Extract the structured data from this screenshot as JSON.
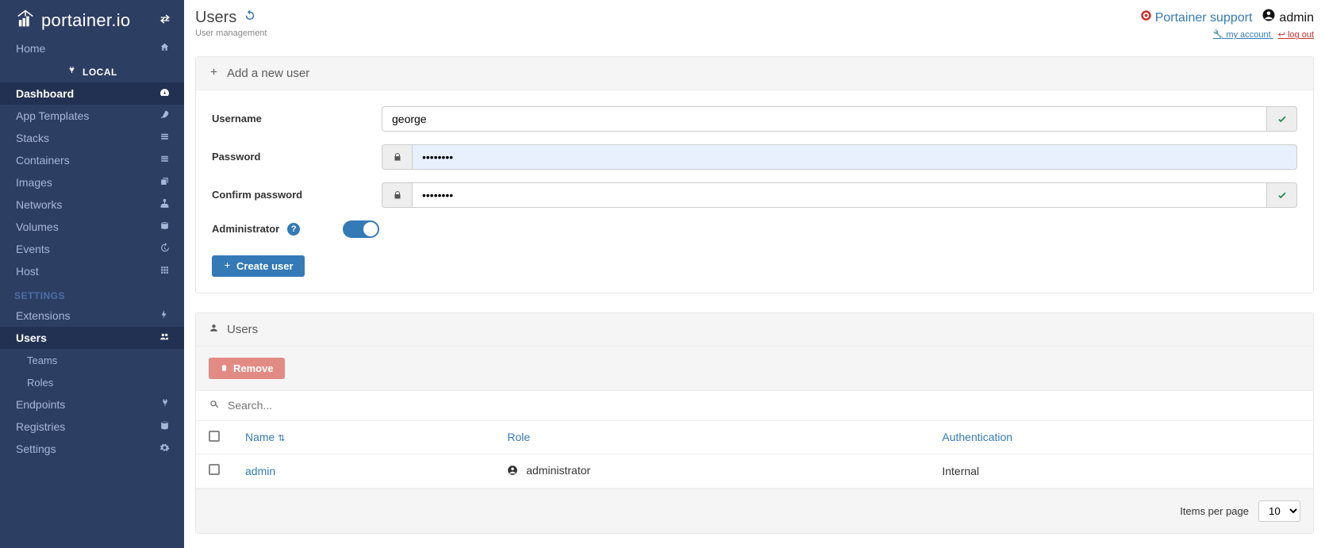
{
  "brand": "portainer.io",
  "sidebar": {
    "home": "Home",
    "local_header": "LOCAL",
    "items": [
      {
        "label": "Dashboard",
        "icon": "tachometer",
        "active": true
      },
      {
        "label": "App Templates",
        "icon": "rocket",
        "active": false
      },
      {
        "label": "Stacks",
        "icon": "list",
        "active": false
      },
      {
        "label": "Containers",
        "icon": "list",
        "active": false
      },
      {
        "label": "Images",
        "icon": "clone",
        "active": false
      },
      {
        "label": "Networks",
        "icon": "sitemap",
        "active": false
      },
      {
        "label": "Volumes",
        "icon": "hdd",
        "active": false
      },
      {
        "label": "Events",
        "icon": "history",
        "active": false
      },
      {
        "label": "Host",
        "icon": "th",
        "active": false
      }
    ],
    "settings_header": "SETTINGS",
    "settings_items": [
      {
        "label": "Extensions",
        "icon": "bolt"
      },
      {
        "label": "Users",
        "icon": "users",
        "active": true,
        "children": [
          {
            "label": "Teams"
          },
          {
            "label": "Roles"
          }
        ]
      },
      {
        "label": "Endpoints",
        "icon": "plug"
      },
      {
        "label": "Registries",
        "icon": "database"
      },
      {
        "label": "Settings",
        "icon": "cogs"
      }
    ]
  },
  "header": {
    "title": "Users",
    "subtitle": "User management",
    "support_label": "Portainer support",
    "username": "admin",
    "my_account_label": "my account",
    "log_out_label": "log out"
  },
  "add_panel": {
    "title": "Add a new user",
    "username_label": "Username",
    "username_value": "george",
    "password_label": "Password",
    "password_value": "••••••••",
    "confirm_label": "Confirm password",
    "confirm_value": "••••••••",
    "admin_label": "Administrator",
    "create_label": "Create user"
  },
  "users_panel": {
    "title": "Users",
    "remove_label": "Remove",
    "search_placeholder": "Search...",
    "columns": {
      "name": "Name",
      "role": "Role",
      "auth": "Authentication"
    },
    "rows": [
      {
        "name": "admin",
        "role": "administrator",
        "auth": "Internal"
      }
    ],
    "paging_label": "Items per page",
    "paging_value": "10"
  }
}
